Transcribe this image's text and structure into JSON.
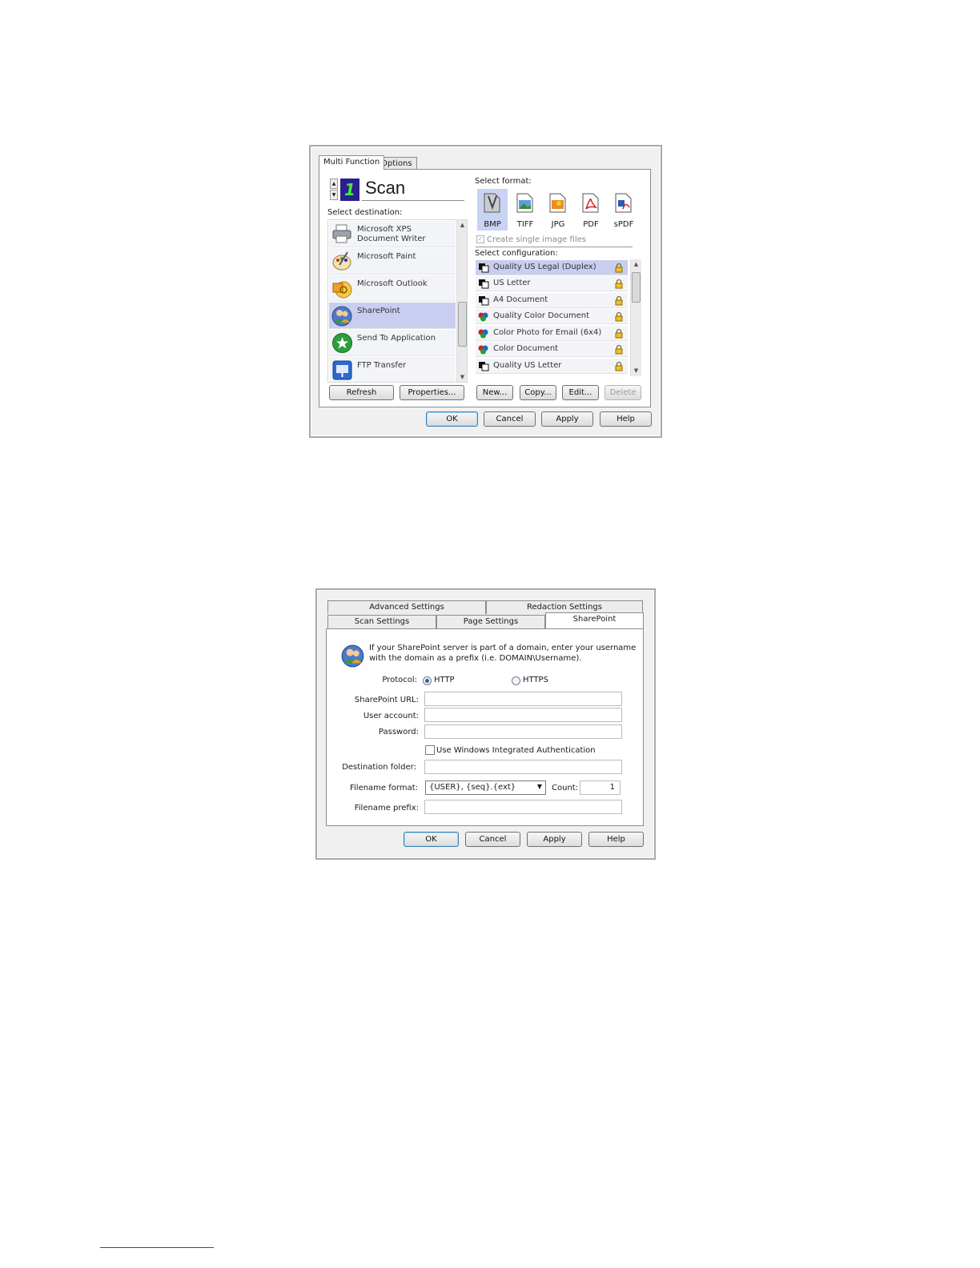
{
  "dialog1": {
    "tabs": [
      "Multi Function",
      "Options"
    ],
    "scan_number": "1",
    "scan_title": "Scan",
    "select_destination_label": "Select destination:",
    "destinations": [
      {
        "label": "Microsoft XPS Document Writer",
        "icon": "printer-icon"
      },
      {
        "label": "Microsoft Paint",
        "icon": "paint-palette-icon"
      },
      {
        "label": "Microsoft Outlook",
        "icon": "outlook-icon"
      },
      {
        "label": "SharePoint",
        "icon": "sharepoint-users-icon",
        "selected": true
      },
      {
        "label": "Send To Application",
        "icon": "send-to-app-icon"
      },
      {
        "label": "FTP Transfer",
        "icon": "ftp-transfer-icon"
      }
    ],
    "select_format_label": "Select format:",
    "formats": [
      {
        "label": "BMP",
        "icon": "bmp-icon",
        "selected": true
      },
      {
        "label": "TIFF",
        "icon": "tiff-icon"
      },
      {
        "label": "JPG",
        "icon": "jpg-icon"
      },
      {
        "label": "PDF",
        "icon": "pdf-icon"
      },
      {
        "label": "sPDF",
        "icon": "spdf-icon"
      }
    ],
    "create_single_image_files": "Create single image files",
    "select_configuration_label": "Select configuration:",
    "configurations": [
      {
        "label": "Quality US Legal (Duplex)",
        "icon": "bw-config-icon",
        "selected": true
      },
      {
        "label": "US Letter",
        "icon": "bw-config-icon"
      },
      {
        "label": "A4 Document",
        "icon": "bw-config-icon"
      },
      {
        "label": "Quality Color Document",
        "icon": "color-config-icon"
      },
      {
        "label": "Color Photo for Email (6x4)",
        "icon": "color-config-icon"
      },
      {
        "label": "Color Document",
        "icon": "color-config-icon"
      },
      {
        "label": "Quality US Letter",
        "icon": "bw-config-icon"
      }
    ],
    "buttons": {
      "refresh": "Refresh",
      "properties": "Properties...",
      "new": "New...",
      "copy": "Copy...",
      "edit": "Edit...",
      "delete": "Delete",
      "ok": "OK",
      "cancel": "Cancel",
      "apply": "Apply",
      "help": "Help"
    }
  },
  "dialog2": {
    "tabs_row1": [
      "Advanced Settings",
      "Redaction Settings"
    ],
    "tabs_row2": [
      "Scan Settings",
      "Page Settings",
      "SharePoint"
    ],
    "info_line1": "If your SharePoint server is part of a domain, enter your username",
    "info_line2": "with the domain as a prefix (i.e. DOMAIN\\Username).",
    "protocol_label": "Protocol:",
    "protocol_http": "HTTP",
    "protocol_https": "HTTPS",
    "sharepoint_url_label": "SharePoint URL:",
    "sharepoint_url_value": "",
    "user_account_label": "User account:",
    "user_account_value": "",
    "password_label": "Password:",
    "password_value": "",
    "windows_auth_label": "Use Windows Integrated Authentication",
    "destination_folder_label": "Destination folder:",
    "destination_folder_value": "",
    "filename_format_label": "Filename format:",
    "filename_format_value": "{USER}, {seq}.{ext}",
    "count_label": "Count:",
    "count_value": "1",
    "filename_prefix_label": "Filename prefix:",
    "filename_prefix_value": "",
    "buttons": {
      "ok": "OK",
      "cancel": "Cancel",
      "apply": "Apply",
      "help": "Help"
    }
  }
}
